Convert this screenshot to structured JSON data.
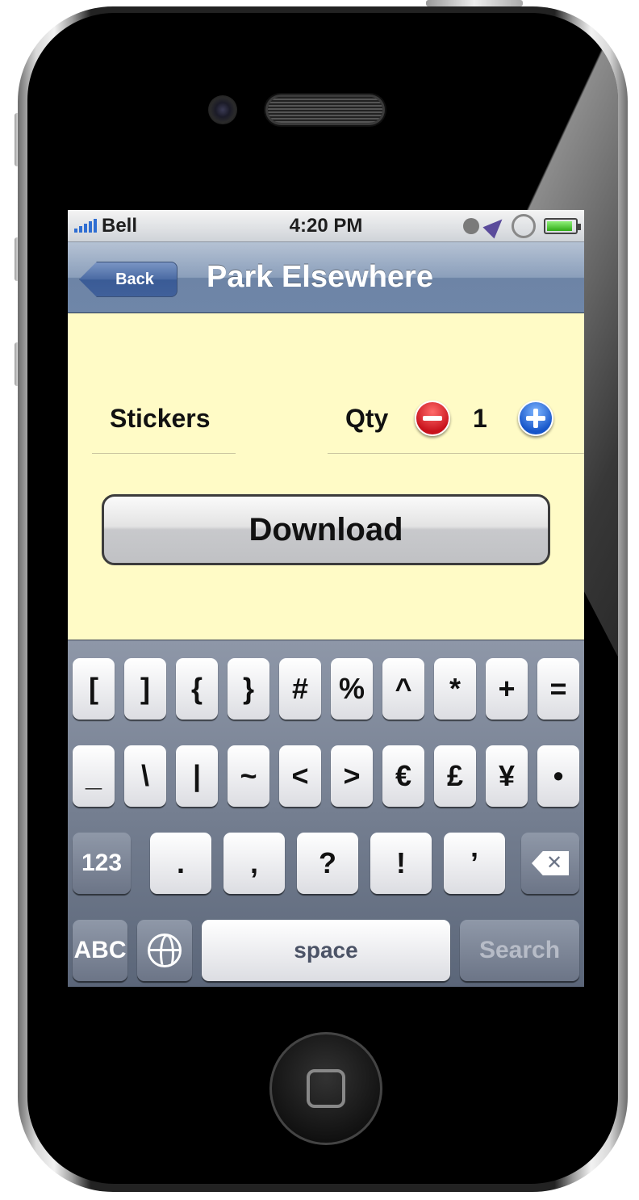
{
  "status_bar": {
    "carrier": "Bell",
    "time": "4:20 PM",
    "battery_level": 0.9
  },
  "nav_bar": {
    "back_label": "Back",
    "title": "Park Elsewhere"
  },
  "order": {
    "item_label": "Stickers",
    "qty_label": "Qty",
    "quantity": "1",
    "download_label": "Download"
  },
  "keyboard": {
    "row1": [
      "[",
      "]",
      "{",
      "}",
      "#",
      "%",
      "^",
      "*",
      "+",
      "="
    ],
    "row2": [
      "_",
      "\\",
      "|",
      "~",
      "<",
      ">",
      "€",
      "£",
      "¥",
      "•"
    ],
    "row3": [
      ".",
      ",",
      "?",
      "!",
      "’"
    ],
    "numbers_key": "123",
    "letters_key": "ABC",
    "space_key": "space",
    "return_key": "Search"
  },
  "colors": {
    "content_background": "#fffbc6",
    "nav_bar": "#7a8fae",
    "minus_button": "#d1202a",
    "plus_button": "#2166d6"
  }
}
